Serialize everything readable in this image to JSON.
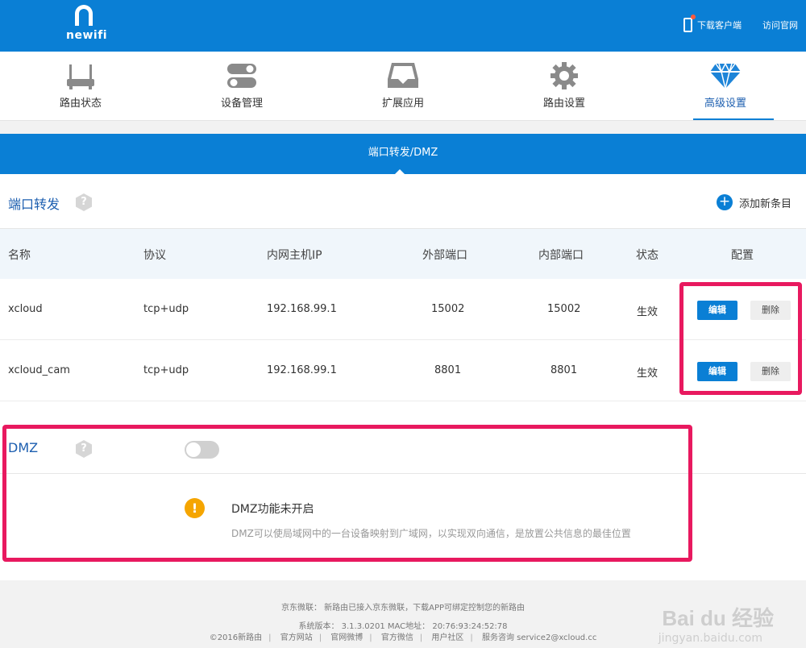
{
  "brand": {
    "logo_text": "newifi"
  },
  "top_links": {
    "download": "下载客户端",
    "official": "访问官网"
  },
  "nav": [
    {
      "label": "路由状态",
      "icon": "router-icon"
    },
    {
      "label": "设备管理",
      "icon": "toggle-devices-icon"
    },
    {
      "label": "扩展应用",
      "icon": "tray-icon"
    },
    {
      "label": "路由设置",
      "icon": "gear-icon"
    },
    {
      "label": "高级设置",
      "icon": "diamond-icon",
      "active": true
    }
  ],
  "section": {
    "title": "端口转发/DMZ"
  },
  "port_forward": {
    "title": "端口转发",
    "help": "?",
    "add_label": "添加新条目",
    "columns": [
      "名称",
      "协议",
      "内网主机IP",
      "外部端口",
      "内部端口",
      "状态",
      "配置"
    ],
    "rows": [
      {
        "name": "xcloud",
        "protocol": "tcp+udp",
        "ip": "192.168.99.1",
        "ext_port": "15002",
        "int_port": "15002",
        "status": "生效",
        "edit": "编辑",
        "delete": "删除"
      },
      {
        "name": "xcloud_cam",
        "protocol": "tcp+udp",
        "ip": "192.168.99.1",
        "ext_port": "8801",
        "int_port": "8801",
        "status": "生效",
        "edit": "编辑",
        "delete": "删除"
      }
    ]
  },
  "dmz": {
    "title": "DMZ",
    "help": "?",
    "enabled": false,
    "warn": "!",
    "status": "DMZ功能未开启",
    "description": "DMZ可以使局域网中的一台设备映射到广域网，以实现双向通信，是放置公共信息的最佳位置"
  },
  "footer": {
    "line1": "京东微联： 新路由已接入京东微联，下载APP可绑定控制您的新路由",
    "line2": "系统版本： 3.1.3.0201    MAC地址： 20:76:93:24:52:78",
    "links": [
      "©2016新路由",
      "官方网站",
      "官网微博",
      "官方微信",
      "用户社区",
      "服务咨询 service2@xcloud.cc"
    ]
  },
  "watermark": {
    "main": "Bai du 经验",
    "sub": "jingyan.baidu.com"
  },
  "colors": {
    "primary": "#0a7fd5",
    "highlight": "#e8195f",
    "warning": "#f5a500"
  }
}
